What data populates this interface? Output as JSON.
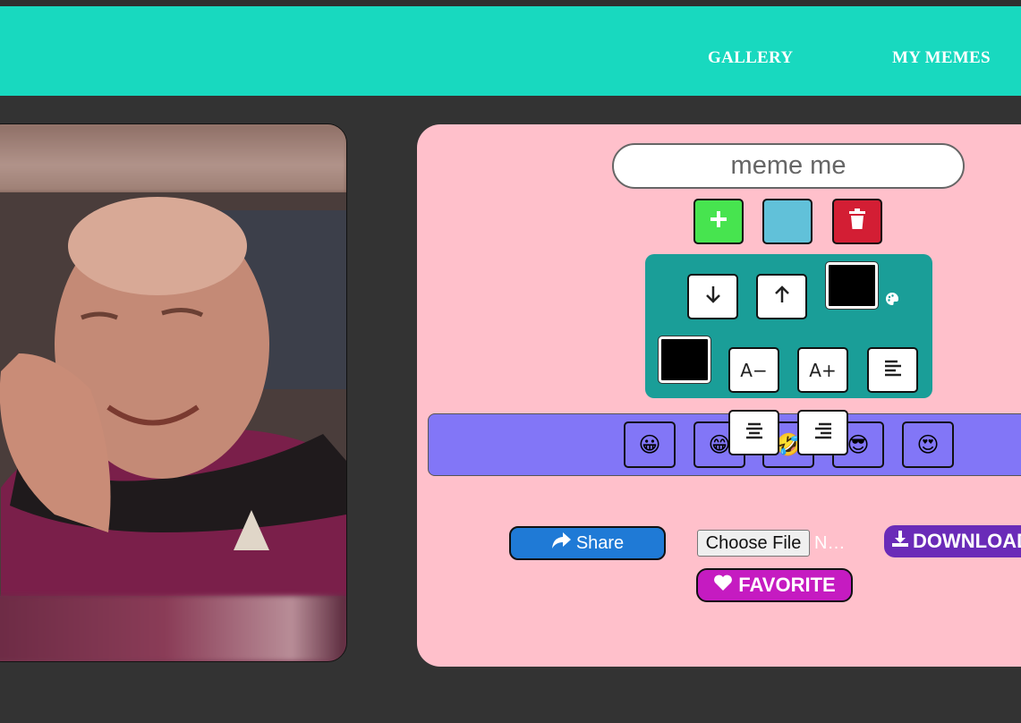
{
  "nav": {
    "gallery": "GALLERY",
    "my_memes": "MY MEMES"
  },
  "colors": {
    "navbar": "#18d9bf",
    "background": "#333333",
    "editor_bg": "#ffc0cb",
    "tool_panel": "#1a9e98",
    "emoji_bar": "#8276f7",
    "add": "#47e44f",
    "color_btn": "#61c1d9",
    "delete": "#d31e34",
    "share": "#1f7ad6",
    "download": "#6a2bb8",
    "favorite": "#c51bc1",
    "swatch": "#000000"
  },
  "editor": {
    "text_input": {
      "placeholder": "meme me",
      "value": ""
    },
    "add_icon": "plus-icon",
    "delete_icon": "trash-icon",
    "tools": {
      "move_down_icon": "arrow-down-icon",
      "move_up_icon": "arrow-up-icon",
      "palette_icon": "palette-icon",
      "font_smaller_label": "A−",
      "font_larger_label": "A+",
      "align_icon": "align-left-icon"
    },
    "emojis": [
      "😀",
      "😁",
      "🤣",
      "😎",
      "😍"
    ],
    "share_label": "Share",
    "file_label": "Choose File",
    "file_status": "N…",
    "download_label": "DOWNLOAD",
    "favorite_label": "FAVORITE"
  }
}
